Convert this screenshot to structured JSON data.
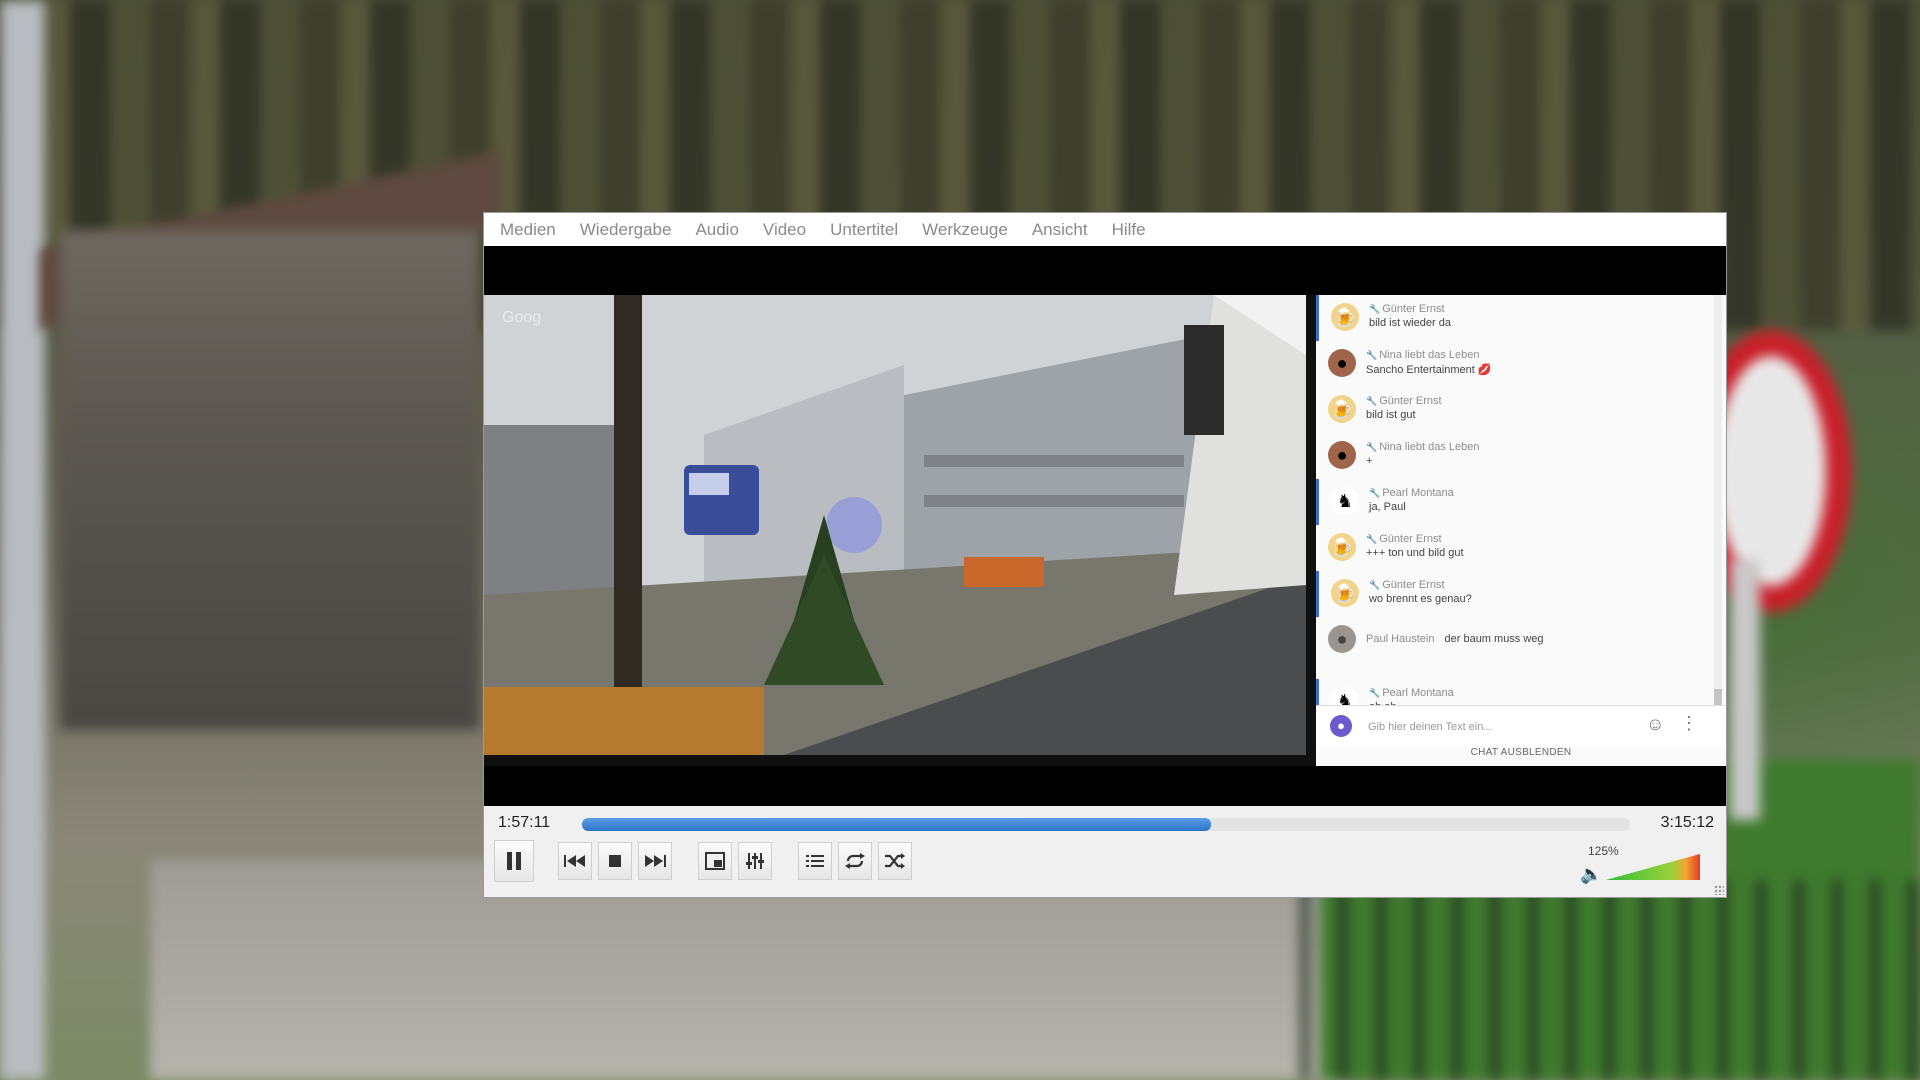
{
  "menu": [
    "Medien",
    "Wiedergabe",
    "Audio",
    "Video",
    "Untertitel",
    "Werkzeuge",
    "Ansicht",
    "Hilfe"
  ],
  "video": {
    "watermark": "Goog"
  },
  "chat": {
    "messages": [
      {
        "name": "Günter Ernst",
        "text": "bild ist wieder da",
        "avatar_icon": "beer-icon",
        "active": true
      },
      {
        "name": "Nina liebt das Leben",
        "text": "Sancho Entertainment 💋",
        "avatar_icon": "person-photo-icon",
        "active": false
      },
      {
        "name": "Günter Ernst",
        "text": "bild ist gut",
        "avatar_icon": "beer-icon",
        "active": false
      },
      {
        "name": "Nina liebt das Leben",
        "text": "+",
        "avatar_icon": "person-photo-icon",
        "active": false
      },
      {
        "name": "Pearl Montana",
        "text": "ja, Paul",
        "avatar_icon": "silhouette-icon",
        "active": true
      },
      {
        "name": "Günter Ernst",
        "text": "+++ ton und bild gut",
        "avatar_icon": "beer-icon",
        "active": false
      },
      {
        "name": "Günter Ernst",
        "text": "wo brennt es genau?",
        "avatar_icon": "beer-icon",
        "active": true
      },
      {
        "name": "Paul Haustein",
        "text": "der baum muss weg",
        "avatar_icon": "grey-photo-icon",
        "active": false,
        "inline": true
      },
      {
        "name": "Pearl Montana",
        "text": "oh oh...",
        "avatar_icon": "silhouette-icon",
        "active": true
      }
    ],
    "input_placeholder": "Gib hier deinen Text ein...",
    "hide_label": "CHAT AUSBLENDEN"
  },
  "player": {
    "time_current": "1:57:11",
    "time_total": "3:15:12",
    "progress": 0.6,
    "volume_label": "125%",
    "volume_level": 1.25,
    "accent": "#2c73c8"
  }
}
